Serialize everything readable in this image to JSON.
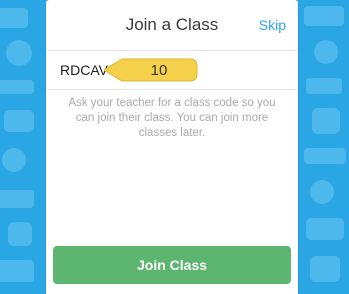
{
  "header": {
    "title": "Join a Class",
    "skip_label": "Skip"
  },
  "form": {
    "class_code_value": "RDCAV",
    "step_badge": "10",
    "helper_text": "Ask your teacher for a class code so you can join their class. You can join more classes later."
  },
  "actions": {
    "join_label": "Join Class"
  },
  "colors": {
    "background": "#2aa6e4",
    "accent": "#2aa6e4",
    "join_button": "#5cb66f",
    "callout": "#f5d04a"
  }
}
